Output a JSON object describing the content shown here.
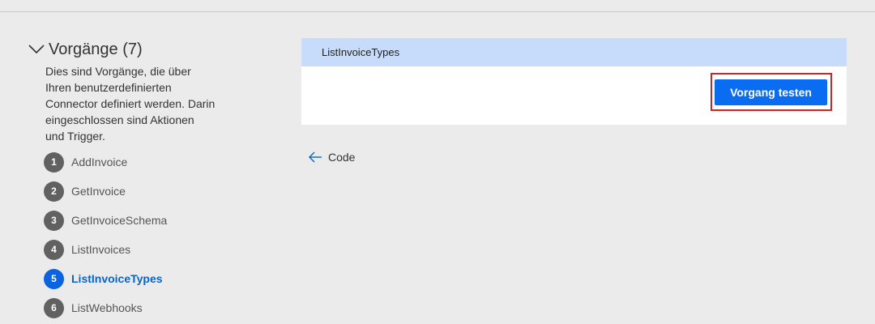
{
  "operations": {
    "title": "Vorgänge (7)",
    "description": "Dies sind Vorgänge, die über Ihren benutzerdefinierten Connector definiert werden. Darin eingeschlossen sind Aktionen und Trigger.",
    "items": [
      {
        "number": "1",
        "label": "AddInvoice",
        "active": false
      },
      {
        "number": "2",
        "label": "GetInvoice",
        "active": false
      },
      {
        "number": "3",
        "label": "GetInvoiceSchema",
        "active": false
      },
      {
        "number": "4",
        "label": "ListInvoices",
        "active": false
      },
      {
        "number": "5",
        "label": "ListInvoiceTypes",
        "active": true
      },
      {
        "number": "6",
        "label": "ListWebhooks",
        "active": false
      }
    ]
  },
  "card": {
    "title": "ListInvoiceTypes",
    "test_button_label": "Vorgang testen"
  },
  "code_link": {
    "label": "Code"
  },
  "icons": {
    "collapse": "chevron-down-icon",
    "back": "arrow-left-icon"
  },
  "colors": {
    "accent": "#0a6cf0",
    "header_band": "#c7dcfa",
    "highlight": "#d32222",
    "badge_inactive": "#616161"
  }
}
